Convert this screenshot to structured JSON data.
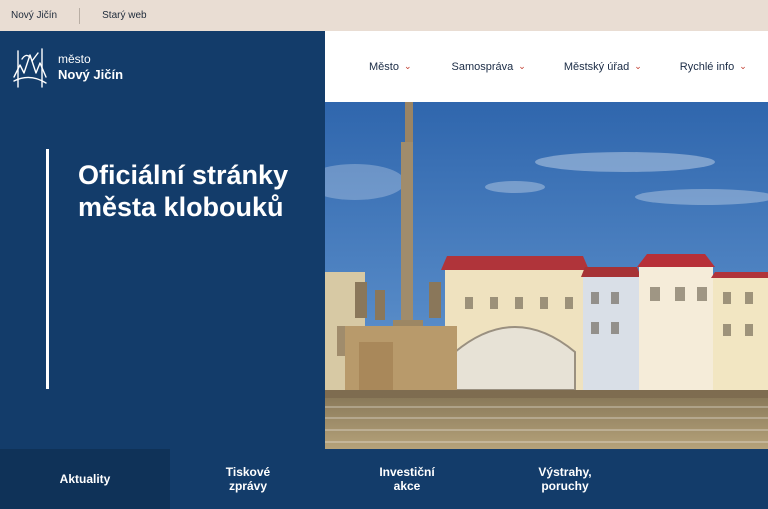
{
  "topbar": {
    "links": [
      "Nový Jičín",
      "Starý web"
    ]
  },
  "logo": {
    "line1": "město",
    "line2": "Nový Jičín"
  },
  "nav": {
    "items": [
      "Město",
      "Samospráva",
      "Městský úřad",
      "Rychlé info"
    ]
  },
  "hero": {
    "title": "Oficiální stránky města klobouků"
  },
  "tabs": {
    "items": [
      "Aktuality",
      "Tiskové\nzprávy",
      "Investiční\nakce",
      "Výstrahy,\nporuchy"
    ],
    "active_index": 0
  },
  "colors": {
    "navy": "#133c6a",
    "topbar_bg": "#e9ddd3",
    "chevron": "#c0392b"
  },
  "icons": [
    "city-coat-of-arms-icon",
    "chevron-down-icon"
  ]
}
